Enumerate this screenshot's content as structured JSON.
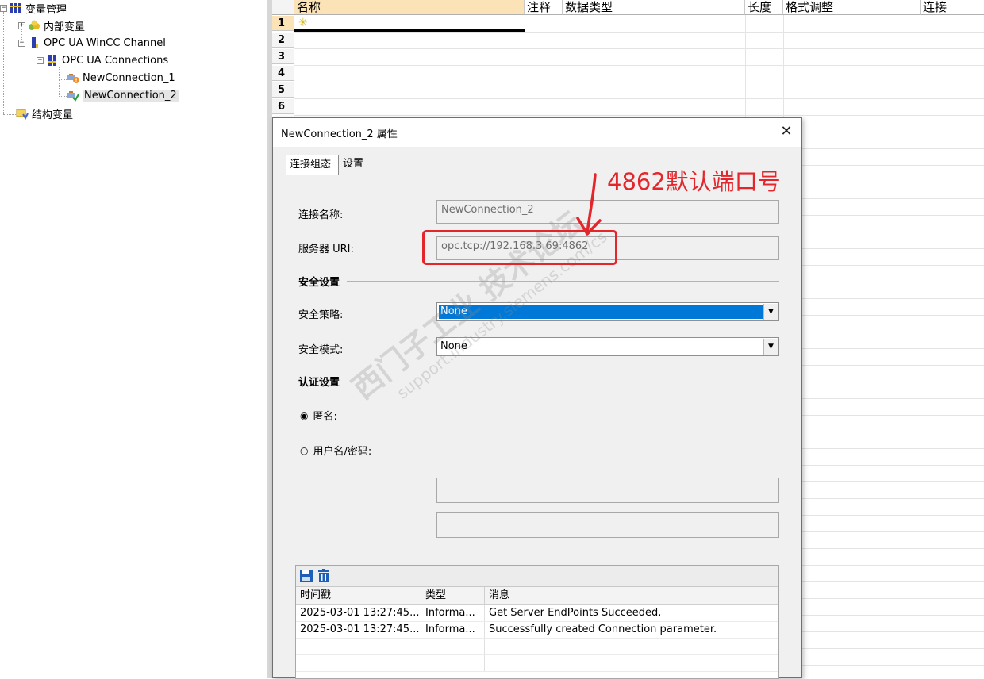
{
  "tree": {
    "root": "变量管理",
    "internal_tags": "内部变量",
    "channel": "OPC UA WinCC Channel",
    "connections": "OPC UA Connections",
    "conn1": "NewConnection_1",
    "conn2": "NewConnection_2",
    "struct_tags": "结构变量",
    "expander_minus": "−",
    "expander_plus": "+"
  },
  "grid": {
    "columns": [
      "名称",
      "注释",
      "数据类型",
      "长度",
      "格式调整",
      "连接"
    ],
    "rows": [
      "1",
      "2",
      "3",
      "4",
      "5",
      "6"
    ],
    "new_row_marker": "✳"
  },
  "dialog": {
    "title": "NewConnection_2 属性",
    "close": "✕",
    "tabs": [
      "连接组态",
      "设置"
    ],
    "conn_name_label": "连接名称:",
    "conn_name_value": "NewConnection_2",
    "server_uri_label": "服务器 URI:",
    "server_uri_value": "opc.tcp://192.168.3.69:4862",
    "security_section": "安全设置",
    "policy_label": "安全策略:",
    "policy_value": "None",
    "mode_label": "安全模式:",
    "mode_value": "None",
    "auth_section": "认证设置",
    "anonymous_label": "匿名:",
    "userpass_label": "用户名/密码:",
    "radio_checked": "◉",
    "radio_unchecked": "○",
    "combo_arrow": "▼"
  },
  "log": {
    "headers": [
      "时间戳",
      "类型",
      "消息"
    ],
    "rows": [
      {
        "time": "2025-03-01 13:27:45...",
        "type": "Informa...",
        "msg": "Get Server EndPoints Succeeded."
      },
      {
        "time": "2025-03-01 13:27:45...",
        "type": "Informa...",
        "msg": "Successfully created Connection parameter."
      }
    ]
  },
  "annotation": {
    "text": "4862默认端口号",
    "color": "#e3262c"
  },
  "watermark": {
    "line1": "西门子工业 技术论坛",
    "line2": "support.industry.siemens.com/cs"
  },
  "colors": {
    "selection_blue": "#0078d7",
    "active_header": "#fbe2b7"
  }
}
